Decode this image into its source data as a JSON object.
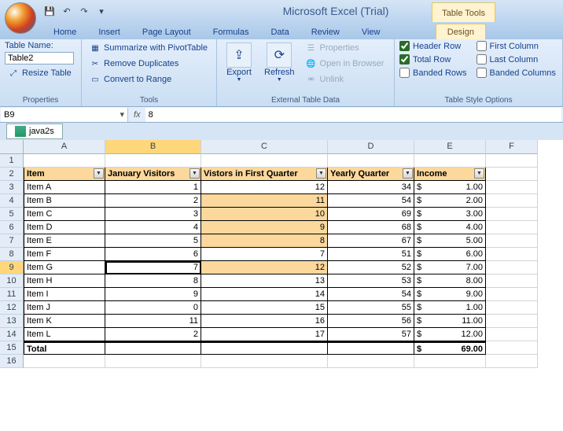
{
  "app_title": "Microsoft Excel (Trial)",
  "context_tab": "Table Tools",
  "tabs": [
    "Home",
    "Insert",
    "Page Layout",
    "Formulas",
    "Data",
    "Review",
    "View",
    "Design"
  ],
  "active_tab": "Design",
  "ribbon": {
    "properties": {
      "table_name_label": "Table Name:",
      "table_name_value": "Table2",
      "resize_label": "Resize Table",
      "group_label": "Properties"
    },
    "tools": {
      "summarize": "Summarize with PivotTable",
      "remove_dup": "Remove Duplicates",
      "convert": "Convert to Range",
      "group_label": "Tools"
    },
    "external": {
      "export": "Export",
      "refresh": "Refresh",
      "props": "Properties",
      "browser": "Open in Browser",
      "unlink": "Unlink",
      "group_label": "External Table Data"
    },
    "styleopts": {
      "header_row": "Header Row",
      "total_row": "Total Row",
      "banded_rows": "Banded Rows",
      "first_col": "First Column",
      "last_col": "Last Column",
      "banded_cols": "Banded Columns",
      "group_label": "Table Style Options"
    }
  },
  "name_box": "B9",
  "formula_value": "8",
  "workbook_name": "java2s",
  "columns": [
    "A",
    "B",
    "C",
    "D",
    "E",
    "F"
  ],
  "active_col": "B",
  "active_row_num": 9,
  "table": {
    "headers": [
      "Item",
      "January Visitors",
      "Vistors in First Quarter",
      "Yearly Quarter",
      "Income"
    ],
    "rows": [
      {
        "item": "Item A",
        "jan": 1,
        "q1": 12,
        "yq": 34,
        "inc": "1.00"
      },
      {
        "item": "Item B",
        "jan": 2,
        "q1": 11,
        "yq": 54,
        "inc": "2.00"
      },
      {
        "item": "Item C",
        "jan": 3,
        "q1": 10,
        "yq": 69,
        "inc": "3.00"
      },
      {
        "item": "Item D",
        "jan": 4,
        "q1": 9,
        "yq": 68,
        "inc": "4.00"
      },
      {
        "item": "Item E",
        "jan": 5,
        "q1": 8,
        "yq": 67,
        "inc": "5.00"
      },
      {
        "item": "Item F",
        "jan": 6,
        "q1": 7,
        "yq": 51,
        "inc": "6.00"
      },
      {
        "item": "Item G",
        "jan": 7,
        "q1": 12,
        "yq": 52,
        "inc": "7.00"
      },
      {
        "item": "Item H",
        "jan": 8,
        "q1": 13,
        "yq": 53,
        "inc": "8.00"
      },
      {
        "item": "Item I",
        "jan": 9,
        "q1": 14,
        "yq": 54,
        "inc": "9.00"
      },
      {
        "item": "Item J",
        "jan": 0,
        "q1": 15,
        "yq": 55,
        "inc": "1.00"
      },
      {
        "item": "Item K",
        "jan": 11,
        "q1": 16,
        "yq": 56,
        "inc": "11.00"
      },
      {
        "item": "Item L",
        "jan": 2,
        "q1": 17,
        "yq": 57,
        "inc": "12.00"
      }
    ],
    "total_label": "Total",
    "total_inc": "69.00"
  },
  "highlight_q1_rows": [
    4,
    5,
    6,
    7,
    9
  ],
  "currency_symbol": "$"
}
